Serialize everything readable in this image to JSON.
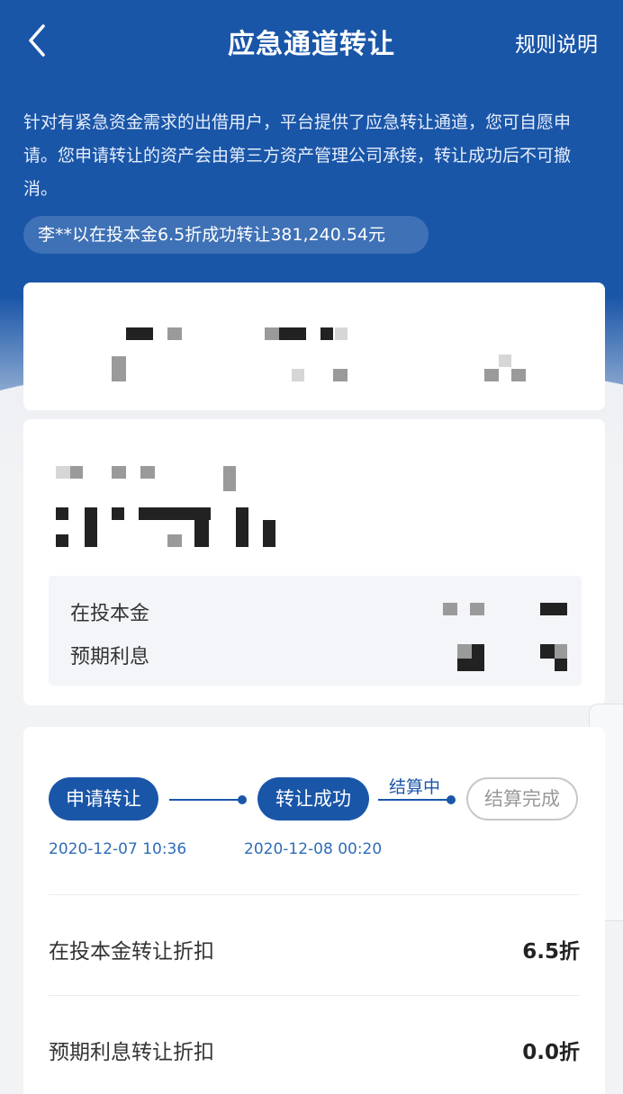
{
  "nav": {
    "title": "应急通道转让",
    "rules_label": "规则说明",
    "back_icon": "chevron-left-icon"
  },
  "intro": {
    "text": "针对有紧急资金需求的出借用户，平台提供了应急转让通道，您可自愿申请。您申请转让的资产会由第三方资产管理公司承接，转让成功后不可撤消。"
  },
  "ticker": {
    "text": "李**以在投本金6.5折成功转让381,240.54元"
  },
  "asset_card": {
    "principal_label": "在投本金",
    "interest_label": "预期利息"
  },
  "progress": {
    "steps": [
      {
        "label": "申请转让",
        "time": "2020-12-07 10:36",
        "status": "done"
      },
      {
        "label": "转让成功",
        "time": "2020-12-08 00:20",
        "status": "done"
      },
      {
        "label": "结算完成",
        "time": "",
        "status": "pending"
      }
    ],
    "current_note": "结算中"
  },
  "discounts": [
    {
      "label": "在投本金转让折扣",
      "value": "6.5折"
    },
    {
      "label": "预期利息转让折扣",
      "value": "0.0折"
    }
  ],
  "colors": {
    "primary": "#1a56a8",
    "background": "#f2f3f5",
    "pending_border": "#c8c8c8"
  }
}
